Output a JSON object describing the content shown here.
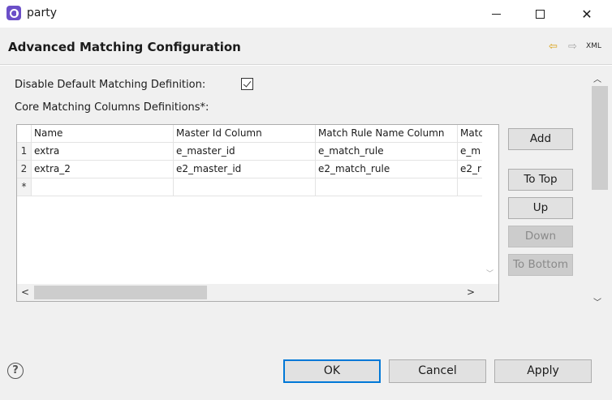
{
  "window": {
    "title": "party"
  },
  "header": {
    "title": "Advanced Matching Configuration",
    "xml_label": "XML"
  },
  "form": {
    "disable_label": "Disable Default Matching Definition:",
    "disable_checked": true,
    "core_label": "Core Matching Columns Definitions*:"
  },
  "table": {
    "columns": [
      "Name",
      "Master Id Column",
      "Match Rule Name Column",
      "Matc"
    ],
    "rows": [
      {
        "index": "1",
        "cells": [
          "extra",
          "e_master_id",
          "e_match_rule",
          "e_m"
        ]
      },
      {
        "index": "2",
        "cells": [
          "extra_2",
          "e2_master_id",
          "e2_match_rule",
          "e2_r"
        ]
      },
      {
        "index": "*",
        "cells": [
          "",
          "",
          "",
          ""
        ]
      }
    ]
  },
  "side_buttons": [
    {
      "label": "Add",
      "enabled": true
    },
    {
      "label": "To Top",
      "enabled": true
    },
    {
      "label": "Up",
      "enabled": true
    },
    {
      "label": "Down",
      "enabled": false
    },
    {
      "label": "To Bottom",
      "enabled": false
    }
  ],
  "footer": {
    "ok_label": "OK",
    "cancel_label": "Cancel",
    "apply_label": "Apply"
  },
  "icons": {
    "app": "app-logo-icon",
    "back": "arrow-left-icon",
    "forward": "arrow-right-icon",
    "help": "help-icon"
  },
  "colors": {
    "accent": "#0078d7",
    "app_icon": "#6b4fc8",
    "back_arrow": "#d9a015"
  }
}
